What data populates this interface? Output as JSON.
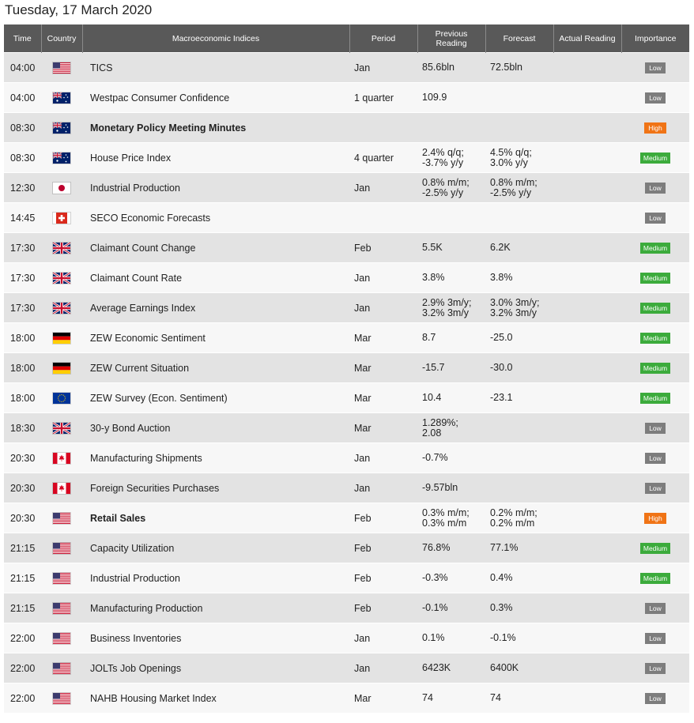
{
  "date_title": "Tuesday, 17 March 2020",
  "columns": {
    "time": "Time",
    "country": "Country",
    "indices": "Macroeconomic Indices",
    "period": "Period",
    "previous": "Previous Reading",
    "forecast": "Forecast",
    "actual": "Actual Reading",
    "importance": "Importance"
  },
  "importance_colors": {
    "Low": "#7d7d7d",
    "Medium": "#3cab3c",
    "High": "#f07416"
  },
  "rows": [
    {
      "time": "04:00",
      "flag": "us-flag-icon",
      "name": "TICS",
      "bold": false,
      "period": "Jan",
      "prev": [
        "85.6bln"
      ],
      "fcst": [
        "72.5bln"
      ],
      "actual": "",
      "importance": "Low"
    },
    {
      "time": "04:00",
      "flag": "au-flag-icon",
      "name": "Westpac Consumer Confidence",
      "bold": false,
      "period": "1 quarter",
      "prev": [
        "109.9"
      ],
      "fcst": [],
      "actual": "",
      "importance": "Low"
    },
    {
      "time": "08:30",
      "flag": "au-flag-icon",
      "name": "Monetary Policy Meeting Minutes",
      "bold": true,
      "period": "",
      "prev": [],
      "fcst": [],
      "actual": "",
      "importance": "High"
    },
    {
      "time": "08:30",
      "flag": "au-flag-icon",
      "name": "House Price Index",
      "bold": false,
      "period": "4 quarter",
      "prev": [
        "2.4% q/q;",
        "-3.7% y/y"
      ],
      "fcst": [
        "4.5% q/q;",
        "3.0% y/y"
      ],
      "actual": "",
      "importance": "Medium"
    },
    {
      "time": "12:30",
      "flag": "jp-flag-icon",
      "name": "Industrial Production",
      "bold": false,
      "period": "Jan",
      "prev": [
        "0.8% m/m;",
        "-2.5% y/y"
      ],
      "fcst": [
        "0.8% m/m;",
        "-2.5% y/y"
      ],
      "actual": "",
      "importance": "Low"
    },
    {
      "time": "14:45",
      "flag": "ch-flag-icon",
      "name": "SECO Economic Forecasts",
      "bold": false,
      "period": "",
      "prev": [],
      "fcst": [],
      "actual": "",
      "importance": "Low"
    },
    {
      "time": "17:30",
      "flag": "uk-flag-icon",
      "name": "Claimant Count Change",
      "bold": false,
      "period": "Feb",
      "prev": [
        "5.5K"
      ],
      "fcst": [
        "6.2K"
      ],
      "actual": "",
      "importance": "Medium"
    },
    {
      "time": "17:30",
      "flag": "uk-flag-icon",
      "name": "Claimant Count Rate",
      "bold": false,
      "period": "Jan",
      "prev": [
        "3.8%"
      ],
      "fcst": [
        "3.8%"
      ],
      "actual": "",
      "importance": "Medium"
    },
    {
      "time": "17:30",
      "flag": "uk-flag-icon",
      "name": "Average Earnings Index",
      "bold": false,
      "period": "Jan",
      "prev": [
        "2.9% 3m/y;",
        "3.2% 3m/y"
      ],
      "fcst": [
        "3.0% 3m/y;",
        "3.2% 3m/y"
      ],
      "actual": "",
      "importance": "Medium"
    },
    {
      "time": "18:00",
      "flag": "de-flag-icon",
      "name": "ZEW Economic Sentiment",
      "bold": false,
      "period": "Mar",
      "prev": [
        "8.7"
      ],
      "fcst": [
        "-25.0"
      ],
      "actual": "",
      "importance": "Medium"
    },
    {
      "time": "18:00",
      "flag": "de-flag-icon",
      "name": "ZEW Current Situation",
      "bold": false,
      "period": "Mar",
      "prev": [
        "-15.7"
      ],
      "fcst": [
        "-30.0"
      ],
      "actual": "",
      "importance": "Medium"
    },
    {
      "time": "18:00",
      "flag": "eu-flag-icon",
      "name": "ZEW Survey (Econ. Sentiment)",
      "bold": false,
      "period": "Mar",
      "prev": [
        "10.4"
      ],
      "fcst": [
        "-23.1"
      ],
      "actual": "",
      "importance": "Medium"
    },
    {
      "time": "18:30",
      "flag": "uk-flag-icon",
      "name": "30-y Bond Auction",
      "bold": false,
      "period": "Mar",
      "prev": [
        "1.289%;",
        "2.08"
      ],
      "fcst": [],
      "actual": "",
      "importance": "Low"
    },
    {
      "time": "20:30",
      "flag": "ca-flag-icon",
      "name": "Manufacturing Shipments",
      "bold": false,
      "period": "Jan",
      "prev": [
        "-0.7%"
      ],
      "fcst": [],
      "actual": "",
      "importance": "Low"
    },
    {
      "time": "20:30",
      "flag": "ca-flag-icon",
      "name": "Foreign Securities Purchases",
      "bold": false,
      "period": "Jan",
      "prev": [
        "-9.57bln"
      ],
      "fcst": [],
      "actual": "",
      "importance": "Low"
    },
    {
      "time": "20:30",
      "flag": "us-flag-icon",
      "name": "Retail Sales",
      "bold": true,
      "period": "Feb",
      "prev": [
        "0.3% m/m;",
        "0.3% m/m"
      ],
      "fcst": [
        "0.2% m/m;",
        "0.2% m/m"
      ],
      "actual": "",
      "importance": "High"
    },
    {
      "time": "21:15",
      "flag": "us-flag-icon",
      "name": "Capacity Utilization",
      "bold": false,
      "period": "Feb",
      "prev": [
        "76.8%"
      ],
      "fcst": [
        "77.1%"
      ],
      "actual": "",
      "importance": "Medium"
    },
    {
      "time": "21:15",
      "flag": "us-flag-icon",
      "name": "Industrial Production",
      "bold": false,
      "period": "Feb",
      "prev": [
        "-0.3%"
      ],
      "fcst": [
        "0.4%"
      ],
      "actual": "",
      "importance": "Medium"
    },
    {
      "time": "21:15",
      "flag": "us-flag-icon",
      "name": "Manufacturing Production",
      "bold": false,
      "period": "Feb",
      "prev": [
        "-0.1%"
      ],
      "fcst": [
        "0.3%"
      ],
      "actual": "",
      "importance": "Low"
    },
    {
      "time": "22:00",
      "flag": "us-flag-icon",
      "name": "Business Inventories",
      "bold": false,
      "period": "Jan",
      "prev": [
        "0.1%"
      ],
      "fcst": [
        "-0.1%"
      ],
      "actual": "",
      "importance": "Low"
    },
    {
      "time": "22:00",
      "flag": "us-flag-icon",
      "name": "JOLTs Job Openings",
      "bold": false,
      "period": "Jan",
      "prev": [
        "6423K"
      ],
      "fcst": [
        "6400K"
      ],
      "actual": "",
      "importance": "Low"
    },
    {
      "time": "22:00",
      "flag": "us-flag-icon",
      "name": "NAHB Housing Market Index",
      "bold": false,
      "period": "Mar",
      "prev": [
        "74"
      ],
      "fcst": [
        "74"
      ],
      "actual": "",
      "importance": "Low"
    }
  ]
}
